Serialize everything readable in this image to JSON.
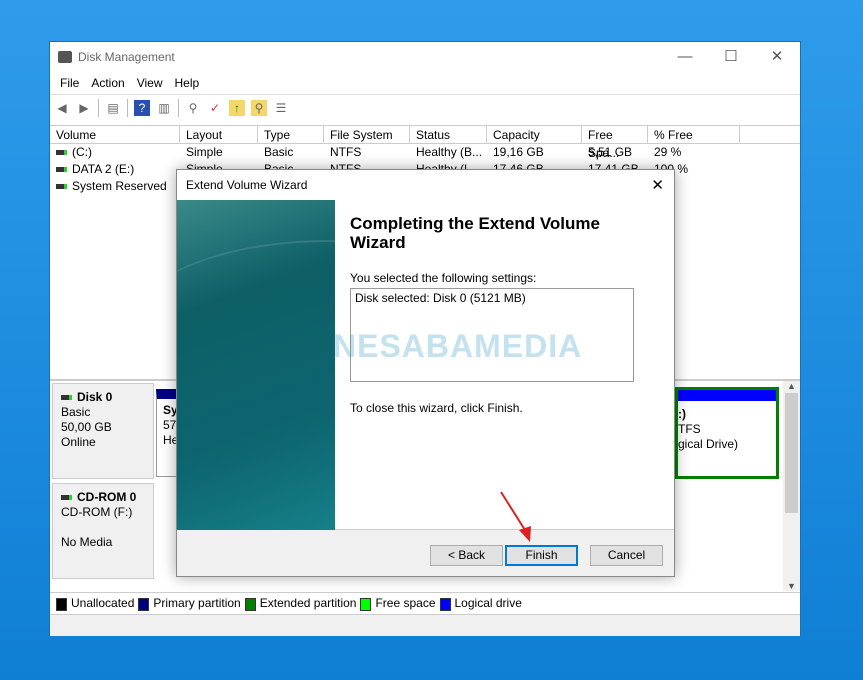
{
  "window": {
    "title": "Disk Management",
    "minimize": "—",
    "maximize": "☐",
    "close": "✕"
  },
  "menu": [
    "File",
    "Action",
    "View",
    "Help"
  ],
  "toolbar": [
    "back-icon",
    "forward-icon",
    "console-tree-icon",
    "help-icon",
    "action-pane-icon",
    "connect-icon",
    "properties-icon",
    "folder-up-icon",
    "folder-search-icon",
    "checklist-icon"
  ],
  "columns": [
    "Volume",
    "Layout",
    "Type",
    "File System",
    "Status",
    "Capacity",
    "Free Spa...",
    "% Free"
  ],
  "volumes": [
    {
      "name": "(C:)",
      "layout": "Simple",
      "type": "Basic",
      "fs": "NTFS",
      "status": "Healthy (B...",
      "capacity": "19,16 GB",
      "free": "5,51 GB",
      "pct": "29 %"
    },
    {
      "name": "DATA 2 (E:)",
      "layout": "Simple",
      "type": "Basic",
      "fs": "NTFS",
      "status": "Healthy (L...",
      "capacity": "17,46 GB",
      "free": "17,41 GB",
      "pct": "100 %"
    },
    {
      "name": "System Reserved",
      "pct": "%"
    }
  ],
  "disks": [
    {
      "name": "Disk 0",
      "type": "Basic",
      "size": "50,00 GB",
      "state": "Online",
      "part1": [
        "Sy",
        "579",
        "He"
      ],
      "part2": [
        ":)",
        "TFS",
        "gical Drive)"
      ]
    },
    {
      "name": "CD-ROM 0",
      "type": "CD-ROM (F:)",
      "state": "No Media"
    }
  ],
  "legend": [
    {
      "label": "Unallocated",
      "color": "#000000"
    },
    {
      "label": "Primary partition",
      "color": "#000080"
    },
    {
      "label": "Extended partition",
      "color": "#008000"
    },
    {
      "label": "Free space",
      "color": "#00ff00"
    },
    {
      "label": "Logical drive",
      "color": "#0000ff"
    }
  ],
  "dialog": {
    "title": "Extend Volume Wizard",
    "close": "✕",
    "heading": "Completing the Extend Volume Wizard",
    "intro": "You selected the following settings:",
    "settings": "Disk selected: Disk 0 (5121 MB)",
    "closing": "To close this wizard, click Finish.",
    "back": "< Back",
    "finish": "Finish",
    "cancel": "Cancel"
  },
  "watermark": "NESABAMEDIA"
}
